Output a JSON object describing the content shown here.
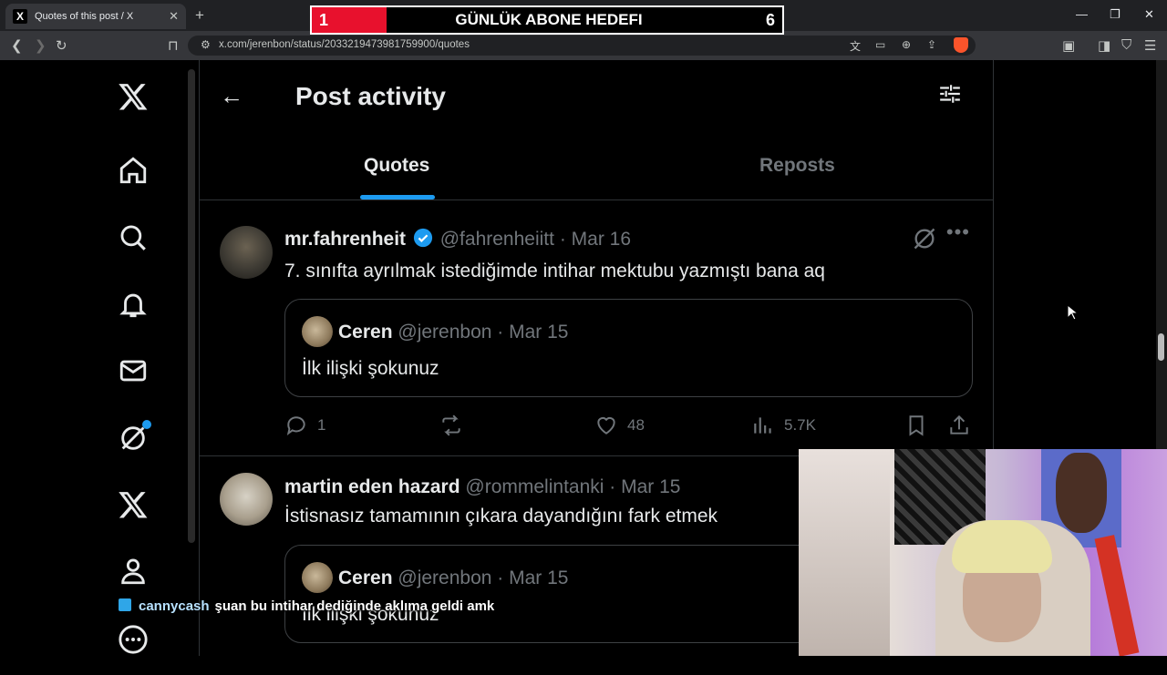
{
  "browser": {
    "tab_title": "Quotes of this post / X",
    "tab_favicon": "X",
    "url": "x.com/jerenbon/status/2033219473981759900/quotes"
  },
  "stream_overlay": {
    "goal_current": "1",
    "goal_label": "GÜNLÜK ABONE HEDEFI",
    "goal_target": "6",
    "chat_user": "cannycash",
    "chat_message": "şuan bu intihar dediğinde aklıma geldi amk"
  },
  "header": {
    "title": "Post activity",
    "back_icon": "←"
  },
  "tabs": [
    {
      "label": "Quotes",
      "active": true
    },
    {
      "label": "Reposts",
      "active": false
    }
  ],
  "posts": [
    {
      "name": "mr.fahrenheit",
      "verified": true,
      "handle": "@fahrenheiitt",
      "date": "· Mar 16",
      "text": "7. sınıfta ayrılmak istediğimde intihar mektubu yazmıştı bana aq",
      "quote": {
        "name": "Ceren",
        "handle": "@jerenbon · Mar 15",
        "text": "İlk ilişki şokunuz"
      },
      "replies": "1",
      "likes": "48",
      "views": "5.7K"
    },
    {
      "name": "martin eden hazard",
      "verified": false,
      "handle": "@rommelintanki",
      "date": "· Mar 15",
      "text": "İstisnasız tamamının çıkara dayandığını fark etmek",
      "quote": {
        "name": "Ceren",
        "handle": "@jerenbon · Mar 15",
        "text": "İlk ilişki şokunuz"
      }
    }
  ],
  "colors": {
    "accent": "#1d9bf0",
    "background": "#000000",
    "text": "#e7e9ea",
    "muted": "#71767b",
    "goal_red": "#e8112d"
  }
}
